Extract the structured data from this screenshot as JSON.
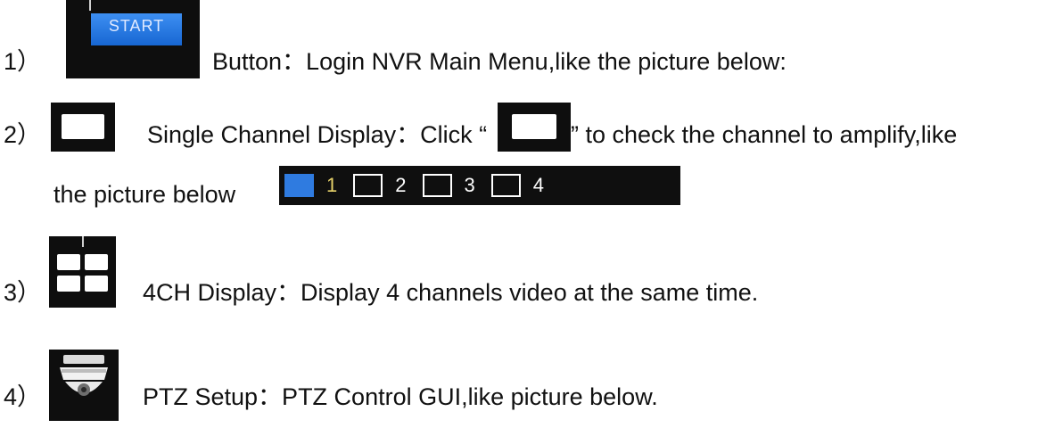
{
  "items": [
    {
      "number": "1）",
      "text": "Button：Login NVR Main Menu,like the picture below:"
    },
    {
      "number": "2）",
      "text_before": "Single Channel Display：Click “",
      "text_after": "” to check the channel to amplify,like",
      "continuation": "the picture below"
    },
    {
      "number": "3）",
      "text": "4CH Display：Display 4 channels video at the same time."
    },
    {
      "number": "4）",
      "text": "PTZ Setup：PTZ Control GUI,like picture below."
    }
  ],
  "start_button": {
    "label": "START",
    "color": "#1e73dc"
  },
  "channel_bar": {
    "channels": [
      "1",
      "2",
      "3",
      "4"
    ],
    "active_color": "#2f7be0",
    "active_label_color": "#e7d26a"
  },
  "icons": [
    "start-button-icon",
    "single-channel-icon",
    "quad-display-icon",
    "ptz-camera-icon"
  ]
}
